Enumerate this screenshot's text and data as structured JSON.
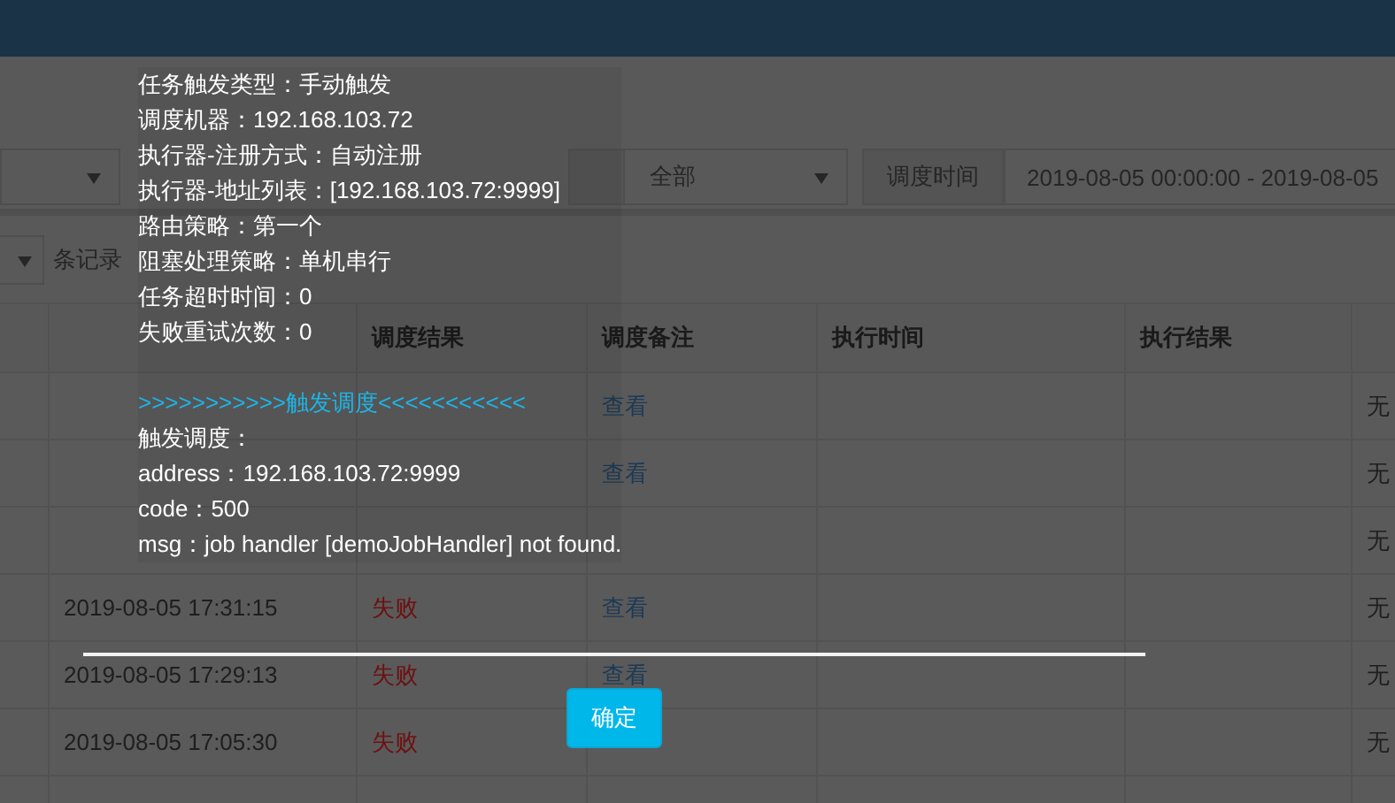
{
  "filters": [
    {
      "kind": "select"
    },
    {
      "kind": "labeled",
      "value": "全部"
    },
    {
      "label": "调度时间",
      "value": "2019-08-05 00:00:00 - 2019-08-05",
      "kind": "range"
    }
  ],
  "page_size": {
    "suffix": "条记录"
  },
  "table": {
    "columns": [
      null,
      null,
      "调度结果",
      "调度备注",
      "执行时间",
      "执行结果",
      null
    ],
    "rows": [
      {
        "cells": [
          null,
          null,
          null,
          "查看",
          null,
          null,
          "无"
        ]
      },
      {
        "cells": [
          null,
          null,
          null,
          "查看",
          null,
          null,
          "无"
        ]
      },
      {
        "cells": [
          null,
          null,
          null,
          null,
          null,
          null,
          "无"
        ]
      },
      {
        "cells": [
          null,
          "2019-08-05 17:31:15",
          "失败",
          "查看",
          null,
          null,
          "无"
        ]
      },
      {
        "cells": [
          null,
          "2019-08-05 17:29:13",
          "失败",
          "查看",
          null,
          null,
          "无"
        ]
      },
      {
        "cells": [
          null,
          "2019-08-05 17:05:30",
          "失败",
          null,
          null,
          null,
          "无"
        ]
      },
      {
        "cells": [
          null,
          null,
          null,
          null,
          null,
          null,
          null
        ]
      }
    ]
  },
  "dialog": {
    "lines": [
      {
        "kind": "info",
        "text": "任务触发类型：手动触发"
      },
      {
        "kind": "info",
        "text": "调度机器：192.168.103.72"
      },
      {
        "kind": "info",
        "text": "执行器-注册方式：自动注册"
      },
      {
        "kind": "info",
        "text": "执行器-地址列表：[192.168.103.72:9999]"
      },
      {
        "kind": "info",
        "text": "路由策略：第一个"
      },
      {
        "kind": "info",
        "text": "阻塞处理策略：单机串行"
      },
      {
        "kind": "info",
        "text": "任务超时时间：0"
      },
      {
        "kind": "info",
        "text": "失败重试次数：0"
      },
      {
        "kind": "title",
        "text": ">>>>>>>>>>>触发调度<<<<<<<<<<<"
      },
      {
        "kind": "info",
        "text": "触发调度："
      },
      {
        "kind": "info",
        "text": "address：192.168.103.72:9999"
      },
      {
        "kind": "info",
        "text": "code：500"
      },
      {
        "kind": "info",
        "text": "msg：job handler [demoJobHandler] not found."
      }
    ],
    "button": "确定"
  }
}
